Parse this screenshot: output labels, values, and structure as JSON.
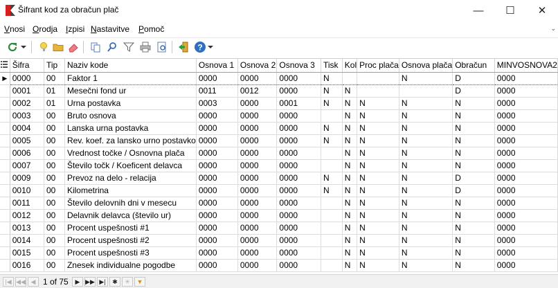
{
  "window": {
    "title": "Šifrant kod za obračun plač",
    "minimize": "—",
    "maximize": "☐",
    "close": "✕"
  },
  "menu": [
    {
      "underline": "V",
      "rest": "nosi"
    },
    {
      "underline": "O",
      "rest": "rodja"
    },
    {
      "underline": "I",
      "rest": "zpisi"
    },
    {
      "underline": "N",
      "rest": "astavitve"
    },
    {
      "underline": "P",
      "rest": "omoč"
    }
  ],
  "menu_overflow": "⌄",
  "toolbar_icons": [
    "refresh-icon",
    "dropdown-arrow-icon",
    "new-record-icon",
    "open-folder-icon",
    "eraser-icon",
    "copy-icon",
    "search-icon",
    "filter-icon",
    "print-icon",
    "print-preview-icon",
    "exit-icon",
    "help-icon",
    "toolbar-overflow-icon"
  ],
  "columns": [
    "",
    "Šifra",
    "Tip",
    "Naziv kode",
    "Osnova 1",
    "Osnova 2",
    "Osnova 3",
    "Tisk",
    "Kol",
    "Proc plača",
    "Osnova plača",
    "Obračun",
    "MINVOSNOVA2"
  ],
  "rows": [
    [
      "▶",
      "0000",
      "00",
      "Faktor 1",
      "0000",
      "0000",
      "0000",
      "N",
      "",
      "",
      "N",
      "D",
      "0000"
    ],
    [
      "",
      "0001",
      "01",
      "Mesečni fond ur",
      "0011",
      "0012",
      "0000",
      "N",
      "N",
      "",
      "",
      "D",
      "0000"
    ],
    [
      "",
      "0002",
      "01",
      "Urna postavka",
      "0003",
      "0000",
      "0001",
      "N",
      "N",
      "N",
      "N",
      "N",
      "0000"
    ],
    [
      "",
      "0003",
      "00",
      "Bruto osnova",
      "0000",
      "0000",
      "0000",
      "",
      "N",
      "N",
      "N",
      "N",
      "0000"
    ],
    [
      "",
      "0004",
      "00",
      "Lanska urna postavka",
      "0000",
      "0000",
      "0000",
      "N",
      "N",
      "N",
      "N",
      "N",
      "0000"
    ],
    [
      "",
      "0005",
      "00",
      "Rev. koef. za lansko urno postavko",
      "0000",
      "0000",
      "0000",
      "N",
      "N",
      "N",
      "N",
      "N",
      "0000"
    ],
    [
      "",
      "0006",
      "00",
      "Vrednost točke / Osnovna plača",
      "0000",
      "0000",
      "0000",
      "",
      "N",
      "N",
      "N",
      "N",
      "0000"
    ],
    [
      "",
      "0007",
      "00",
      "Število točk / Koeficent delavca",
      "0000",
      "0000",
      "0000",
      "",
      "N",
      "N",
      "N",
      "N",
      "0000"
    ],
    [
      "",
      "0009",
      "00",
      "Prevoz na delo - relacija",
      "0000",
      "0000",
      "0000",
      "N",
      "N",
      "N",
      "N",
      "D",
      "0000"
    ],
    [
      "",
      "0010",
      "00",
      "Kilometrina",
      "0000",
      "0000",
      "0000",
      "N",
      "N",
      "N",
      "N",
      "D",
      "0000"
    ],
    [
      "",
      "0011",
      "00",
      "Število delovnih dni v mesecu",
      "0000",
      "0000",
      "0000",
      "",
      "N",
      "N",
      "N",
      "N",
      "0000"
    ],
    [
      "",
      "0012",
      "00",
      "Delavnik delavca (število ur)",
      "0000",
      "0000",
      "0000",
      "",
      "N",
      "N",
      "N",
      "N",
      "0000"
    ],
    [
      "",
      "0013",
      "00",
      "Procent uspešnosti #1",
      "0000",
      "0000",
      "0000",
      "",
      "N",
      "N",
      "N",
      "N",
      "0000"
    ],
    [
      "",
      "0014",
      "00",
      "Procent uspešnosti #2",
      "0000",
      "0000",
      "0000",
      "",
      "N",
      "N",
      "N",
      "N",
      "0000"
    ],
    [
      "",
      "0015",
      "00",
      "Procent uspešnosti #3",
      "0000",
      "0000",
      "0000",
      "",
      "N",
      "N",
      "N",
      "N",
      "0000"
    ],
    [
      "",
      "0016",
      "00",
      "Znesek individualne pogodbe",
      "0000",
      "0000",
      "0000",
      "",
      "N",
      "N",
      "N",
      "N",
      "0000"
    ]
  ],
  "navigator": {
    "record_info": "1 of 75",
    "buttons": [
      "|◀",
      "◀◀",
      "◀",
      "▶",
      "▶▶",
      "▶|",
      "✱",
      "✳",
      "▼"
    ]
  }
}
